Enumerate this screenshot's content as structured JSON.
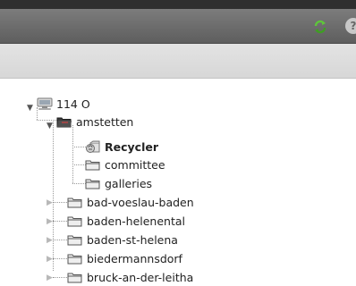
{
  "toolbar": {
    "refresh_icon": "refresh-icon",
    "help_icon": "help-icon",
    "help_glyph": "?"
  },
  "tree": {
    "root": {
      "label": "114 O",
      "icon": "server-icon",
      "expanded": true
    },
    "site": {
      "label": "amstetten",
      "icon": "folder-open-icon",
      "expanded": true
    },
    "site_children": [
      {
        "label": "Recycler",
        "icon": "recycler-icon",
        "bold": true
      },
      {
        "label": "committee",
        "icon": "folder-icon",
        "bold": false
      },
      {
        "label": "galleries",
        "icon": "folder-icon",
        "bold": false
      }
    ],
    "siblings": [
      {
        "label": "bad-voeslau-baden",
        "icon": "folder-icon"
      },
      {
        "label": "baden-helenental",
        "icon": "folder-icon"
      },
      {
        "label": "baden-st-helena",
        "icon": "folder-icon"
      },
      {
        "label": "biedermannsdorf",
        "icon": "folder-icon"
      },
      {
        "label": "bruck-an-der-leitha",
        "icon": "folder-icon"
      }
    ]
  }
}
